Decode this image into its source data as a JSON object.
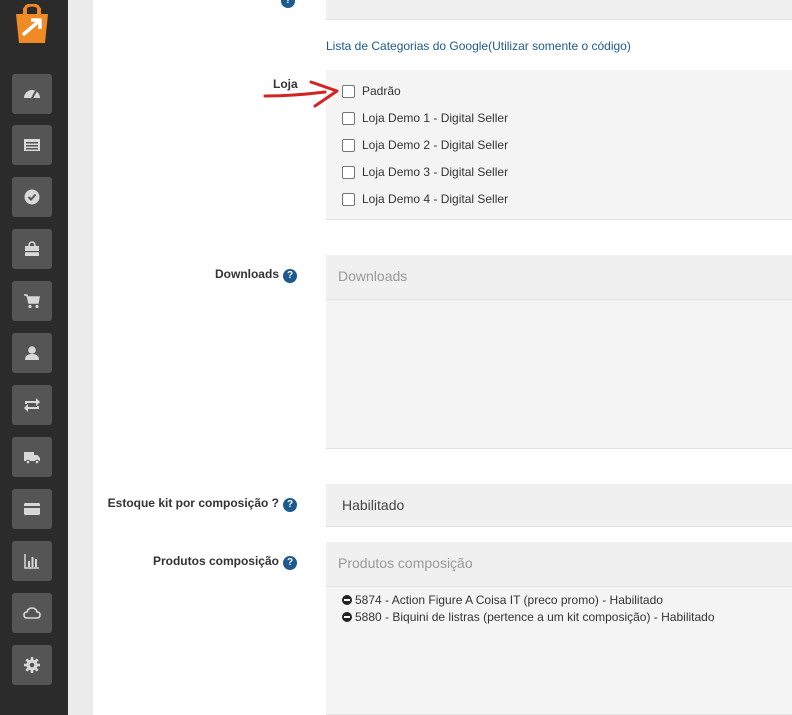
{
  "sidebar": {
    "items": [
      {
        "icon": "dashboard-icon"
      },
      {
        "icon": "catalog-icon"
      },
      {
        "icon": "check-icon"
      },
      {
        "icon": "shopping-bag-icon"
      },
      {
        "icon": "cart-icon"
      },
      {
        "icon": "user-icon"
      },
      {
        "icon": "exchange-icon"
      },
      {
        "icon": "truck-icon"
      },
      {
        "icon": "credit-card-icon"
      },
      {
        "icon": "chart-icon"
      },
      {
        "icon": "cloud-icon"
      },
      {
        "icon": "gear-icon"
      }
    ]
  },
  "form": {
    "google_link": "Lista de Categorias do Google(Utilizar somente o código)",
    "loja": {
      "label": "Loja",
      "options": [
        {
          "label": "Padrão",
          "checked": false
        },
        {
          "label": "Loja Demo 1 - Digital Seller",
          "checked": false
        },
        {
          "label": "Loja Demo 2 - Digital Seller",
          "checked": false
        },
        {
          "label": "Loja Demo 3 - Digital Seller",
          "checked": false
        },
        {
          "label": "Loja Demo 4 - Digital Seller",
          "checked": false
        }
      ]
    },
    "downloads": {
      "label": "Downloads",
      "placeholder": "Downloads",
      "help": "?"
    },
    "estoque": {
      "label": "Estoque kit por composição ?",
      "value": "Habilitado",
      "help": "?"
    },
    "produtos": {
      "label": "Produtos composição",
      "placeholder": "Produtos composição",
      "help": "?",
      "items": [
        "5874 - Action Figure A Coisa IT (preco promo) - Habilitado",
        "5880 - Biquini de listras (pertence a um kit composição) - Habilitado"
      ]
    }
  },
  "colors": {
    "sidebar": "#2b2b2b",
    "accent": "#1d5a8f",
    "arrow": "#d32424",
    "logo": "#f08a24"
  }
}
